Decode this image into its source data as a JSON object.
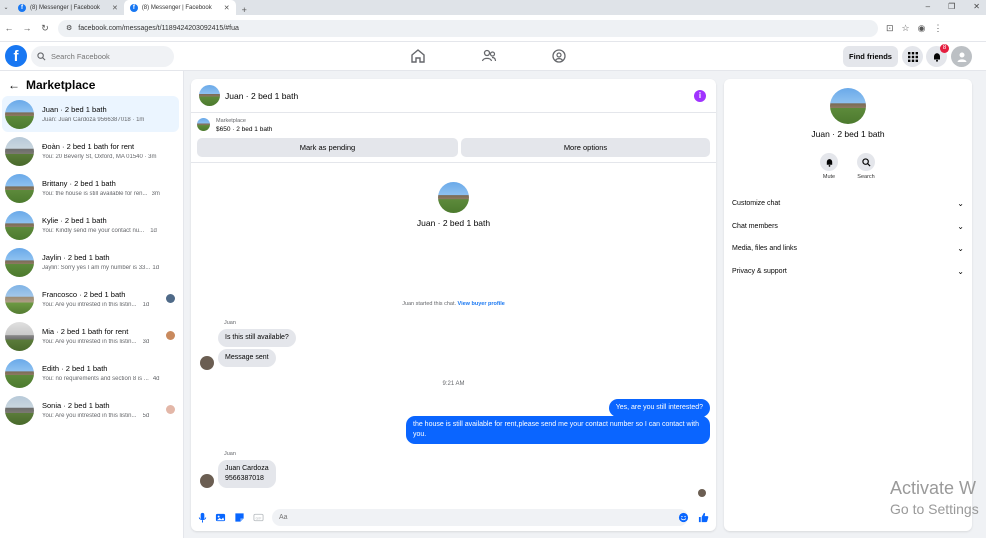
{
  "browser": {
    "tabs": [
      {
        "title": "(8) Messenger | Facebook",
        "active": false
      },
      {
        "title": "(8) Messenger | Facebook",
        "active": true
      }
    ],
    "url": "facebook.com/messages/t/1189424203092415/#fua"
  },
  "header": {
    "search_placeholder": "Search Facebook",
    "find_friends": "Find friends",
    "notification_count": "8"
  },
  "sidebar": {
    "title": "Marketplace",
    "conversations": [
      {
        "name": "Juan · 2 bed 1 bath",
        "preview": "Juan: Juan Cardoza 9566387018 · 1m",
        "time": "",
        "active": true
      },
      {
        "name": "Đoàn · 2 bed 1 bath for rent",
        "preview": "You: 20 Beverly St, Oxford, MA 01540 · 3m",
        "time": "",
        "active": false
      },
      {
        "name": "Brittany · 2 bed 1 bath",
        "preview": "You: the house is still available for ren...",
        "time": "3m",
        "active": false
      },
      {
        "name": "Kylie · 2 bed 1 bath",
        "preview": "You: Kindly send me your contact nu...",
        "time": "1d",
        "active": false
      },
      {
        "name": "Jaylin · 2 bed 1 bath",
        "preview": "Jaylin: Sorry yes I am my number is 33...",
        "time": "1d",
        "active": false
      },
      {
        "name": "Francosco · 2 bed 1 bath",
        "preview": "You: Are you intrested in this listin...",
        "time": "1d",
        "active": false
      },
      {
        "name": "Mia · 2 bed 1 bath for rent",
        "preview": "You: Are you intrested in this listin...",
        "time": "3d",
        "active": false
      },
      {
        "name": "Edith · 2 bed 1 bath",
        "preview": "You: no requirements and section 8 is ...",
        "time": "4d",
        "active": false
      },
      {
        "name": "Sonia · 2 bed 1 bath",
        "preview": "You: Are you intrested in this listin...",
        "time": "5d",
        "active": false
      }
    ]
  },
  "chat": {
    "title": "Juan · 2 bed 1 bath",
    "marketplace_label": "Marketplace",
    "listing": "$650 · 2 bed 1 bath",
    "mark_pending": "Mark as pending",
    "more_options": "More options",
    "center_name": "Juan · 2 bed 1 bath",
    "started_text": "Juan started this chat.",
    "view_buyer": "View buyer profile",
    "sender1": "Juan",
    "msg1": "Is this still available?",
    "msg2": "Message sent",
    "timestamp": "9:21 AM",
    "out1": "Yes, are you still interested?",
    "out2": "the house is still available for rent,please send me your contact number so I can contact with you.",
    "sender2": "Juan",
    "msg3_line1": "Juan Cardoza",
    "msg3_line2": "9566387018",
    "composer_placeholder": "Aa"
  },
  "right_panel": {
    "name": "Juan · 2 bed 1 bath",
    "mute": "Mute",
    "search": "Search",
    "sections": [
      "Customize chat",
      "Chat members",
      "Media, files and links",
      "Privacy & support"
    ]
  },
  "watermark": {
    "line1": "Activate W",
    "line2": "Go to Settings"
  }
}
